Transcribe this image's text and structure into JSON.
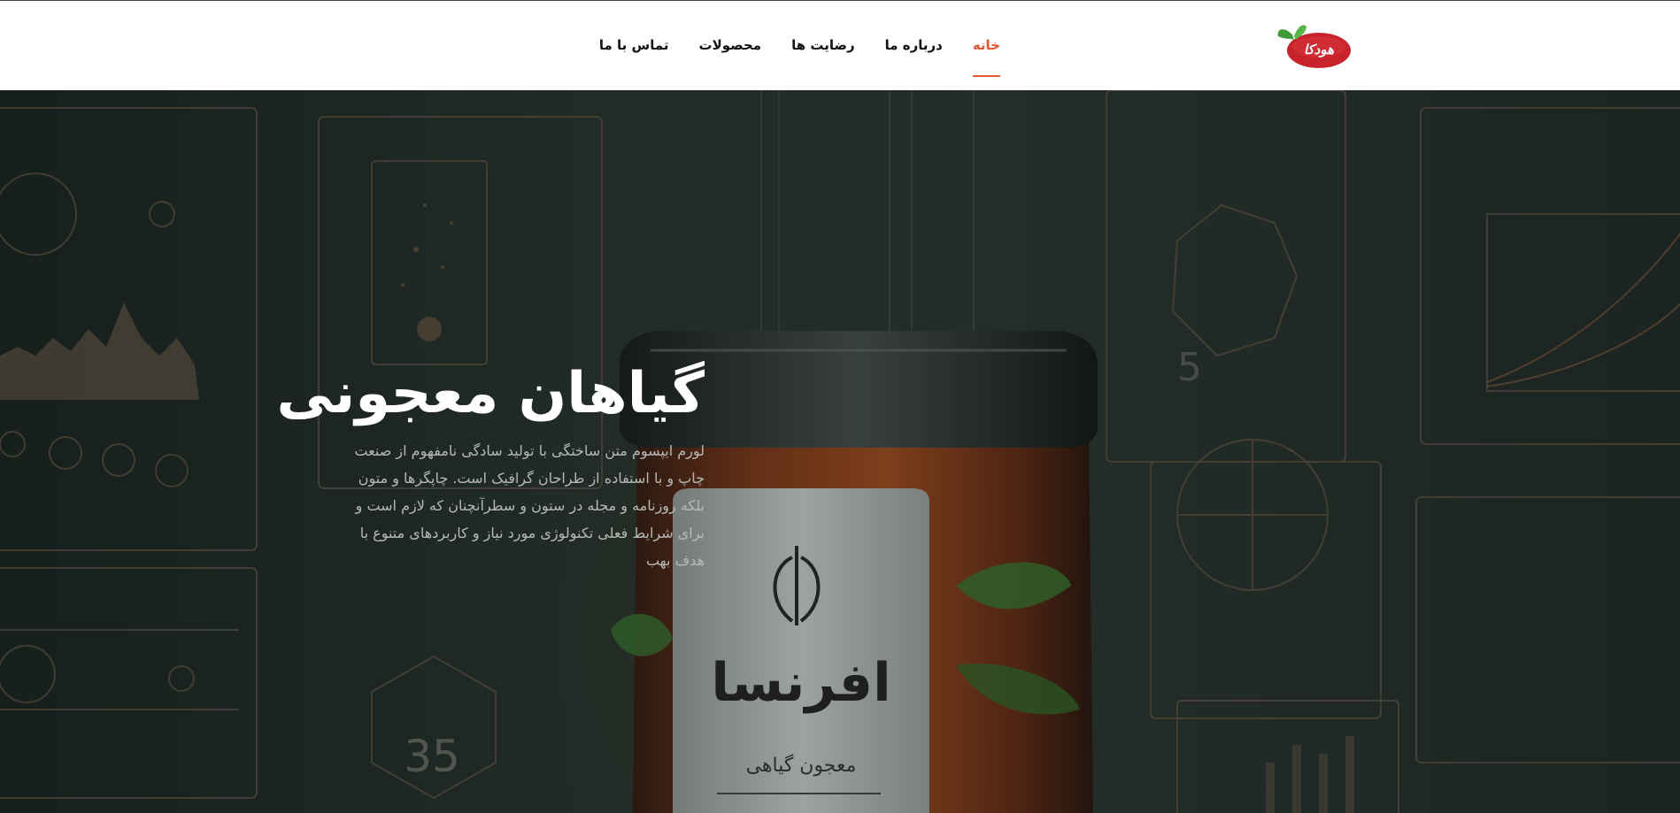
{
  "header": {
    "logo_text": "هودکا",
    "nav": [
      {
        "label": "خانه",
        "active": true
      },
      {
        "label": "درباره ما",
        "active": false
      },
      {
        "label": "رضایت ها",
        "active": false
      },
      {
        "label": "محصولات",
        "active": false
      },
      {
        "label": "تماس با ما",
        "active": false
      }
    ]
  },
  "hero": {
    "title": "گیاهان معجونی",
    "description": "لورم ایپسوم متن ساختگی با تولید سادگی نامفهوم از صنعت چاپ و با استفاده از طراحان گرافیک است. چاپگرها و متون بلکه روزنامه و مجله در ستون و سطرآنچنان که لازم است و برای شرایط فعلی تکنولوژی مورد نیاز و کاربردهای متنوع با هدف بهب",
    "jar_brand": "افرنسا",
    "jar_subtitle": "معجون گیاهی",
    "bg_number_1": "35",
    "bg_number_2": "5"
  },
  "colors": {
    "accent": "#e4572e",
    "header_bg": "#ffffff",
    "hero_text": "#b7b9b6",
    "logo_red": "#c8232c",
    "logo_leaf": "#3f9b3a"
  }
}
